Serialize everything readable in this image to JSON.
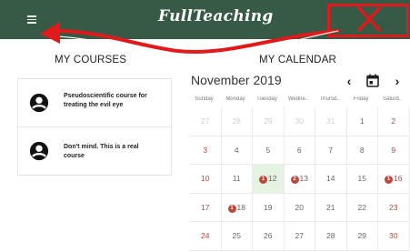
{
  "header": {
    "brand": "FullTeaching",
    "background": "#375a46",
    "menu_icon": "hamburger-menu-icon",
    "close_icon": "close-icon"
  },
  "courses": {
    "title": "MY COURSES",
    "items": [
      {
        "name": "Pseudoscientific course for treating the evil eye"
      },
      {
        "name": "Don't mind. This is a real course"
      }
    ]
  },
  "calendar": {
    "title": "MY CALENDAR",
    "month_label": "November 2019",
    "prev_label": "‹",
    "next_label": "›",
    "today_icon": "calendar-today-icon",
    "weekdays": [
      "Sunday",
      "Monday",
      "Tuesday",
      "Wedne..",
      "Thursd..",
      "Friday",
      "Saturd.."
    ],
    "weeks": [
      [
        {
          "d": "27",
          "o": true
        },
        {
          "d": "28",
          "o": true
        },
        {
          "d": "29",
          "o": true
        },
        {
          "d": "30",
          "o": true
        },
        {
          "d": "31",
          "o": true
        },
        {
          "d": "1"
        },
        {
          "d": "2"
        }
      ],
      [
        {
          "d": "3"
        },
        {
          "d": "4"
        },
        {
          "d": "5"
        },
        {
          "d": "6"
        },
        {
          "d": "7"
        },
        {
          "d": "8"
        },
        {
          "d": "9"
        }
      ],
      [
        {
          "d": "10"
        },
        {
          "d": "11"
        },
        {
          "d": "12",
          "badge": "1",
          "today": true
        },
        {
          "d": "13",
          "badge": "2"
        },
        {
          "d": "14"
        },
        {
          "d": "15"
        },
        {
          "d": "16",
          "badge": "1"
        }
      ],
      [
        {
          "d": "17"
        },
        {
          "d": "18",
          "badge": "1"
        },
        {
          "d": "19"
        },
        {
          "d": "20"
        },
        {
          "d": "21"
        },
        {
          "d": "22"
        },
        {
          "d": "23"
        }
      ],
      [
        {
          "d": "24"
        },
        {
          "d": "25"
        },
        {
          "d": "26"
        },
        {
          "d": "27"
        },
        {
          "d": "28"
        },
        {
          "d": "29"
        },
        {
          "d": "30"
        }
      ]
    ]
  },
  "colors": {
    "accent_red": "#c0463c",
    "annotation_red": "#e0191a",
    "today_bg": "#e6f3e3"
  }
}
